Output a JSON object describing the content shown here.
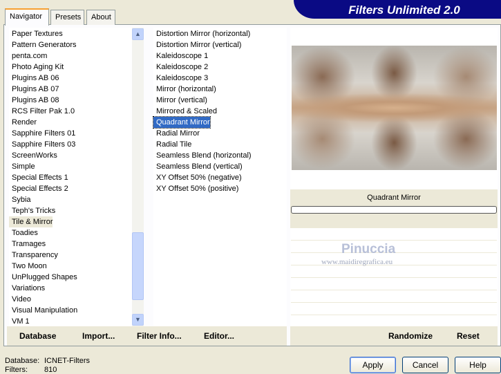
{
  "title": "Filters Unlimited 2.0",
  "tabs": [
    "Navigator",
    "Presets",
    "About"
  ],
  "categories": [
    "Paper Textures",
    "Pattern Generators",
    "penta.com",
    "Photo Aging Kit",
    "Plugins AB 06",
    "Plugins AB 07",
    "Plugins AB 08",
    "RCS Filter Pak 1.0",
    "Render",
    "Sapphire Filters 01",
    "Sapphire Filters 03",
    "ScreenWorks",
    "Simple",
    "Special Effects 1",
    "Special Effects 2",
    "Sybia",
    "Teph's Tricks",
    "Tile & Mirror",
    "Toadies",
    "Tramages",
    "Transparency",
    "Two Moon",
    "UnPlugged Shapes",
    "Variations",
    "Video",
    "Visual Manipulation",
    "VM 1"
  ],
  "selected_category": "Tile & Mirror",
  "filters": [
    "Distortion Mirror (horizontal)",
    "Distortion Mirror (vertical)",
    "Kaleidoscope 1",
    "Kaleidoscope 2",
    "Kaleidoscope 3",
    "Mirror (horizontal)",
    "Mirror (vertical)",
    "Mirrored & Scaled",
    "Quadrant Mirror",
    "Radial Mirror",
    "Radial Tile",
    "Seamless Blend (horizontal)",
    "Seamless Blend (vertical)",
    "XY Offset 50% (negative)",
    "XY Offset 50% (positive)"
  ],
  "selected_filter": "Quadrant Mirror",
  "preview_label": "Quadrant Mirror",
  "progress": 0,
  "watermark": {
    "name": "Pinuccia",
    "url": "www.maidiregrafica.eu"
  },
  "left_buttons": [
    "Database",
    "Import...",
    "Filter Info...",
    "Editor..."
  ],
  "right_buttons": [
    "Randomize",
    "Reset"
  ],
  "status": {
    "database_label": "Database:",
    "database_value": "ICNET-Filters",
    "filters_label": "Filters:",
    "filters_value": "810"
  },
  "dialog_buttons": {
    "apply": "Apply",
    "cancel": "Cancel",
    "help": "Help"
  }
}
